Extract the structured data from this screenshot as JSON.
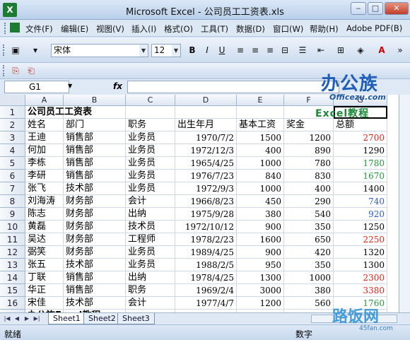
{
  "window": {
    "title": "Microsoft Excel - 公司员工工资表.xls",
    "app_icon": "X"
  },
  "menu": [
    "文件(F)",
    "编辑(E)",
    "视图(V)",
    "插入(I)",
    "格式(O)",
    "工具(T)",
    "数据(D)",
    "窗口(W)",
    "帮助(H)",
    "Adobe PDF(B)"
  ],
  "toolbar": {
    "font_name": "宋体",
    "font_size": "12",
    "bold": "B",
    "italic": "I",
    "underline": "U",
    "font_color_label": "A"
  },
  "formula_bar": {
    "name_box": "G1",
    "fx": "fx",
    "formula": ""
  },
  "columns": [
    "A",
    "B",
    "C",
    "D",
    "E",
    "F",
    "G"
  ],
  "rows": [
    [
      "1",
      "公司员工工资表",
      "",
      "",
      "",
      "",
      "",
      ""
    ],
    [
      "2",
      "姓名",
      "部门",
      "职务",
      "出生年月",
      "基本工资",
      "奖金",
      "总额"
    ],
    [
      "3",
      "王迪",
      "销售部",
      "业务员",
      "1970/7/2",
      "1500",
      "1200",
      "2700"
    ],
    [
      "4",
      "何加",
      "销售部",
      "业务员",
      "1972/12/3",
      "400",
      "890",
      "1290"
    ],
    [
      "5",
      "李栋",
      "销售部",
      "业务员",
      "1965/4/25",
      "1000",
      "780",
      "1780"
    ],
    [
      "6",
      "李研",
      "销售部",
      "业务员",
      "1976/7/23",
      "840",
      "830",
      "1670"
    ],
    [
      "7",
      "张飞",
      "技术部",
      "业务员",
      "1972/9/3",
      "1000",
      "400",
      "1400"
    ],
    [
      "8",
      "刘海涛",
      "财务部",
      "会计",
      "1966/8/23",
      "450",
      "290",
      "740"
    ],
    [
      "9",
      "陈志",
      "财务部",
      "出纳",
      "1975/9/28",
      "380",
      "540",
      "920"
    ],
    [
      "10",
      "黄磊",
      "财务部",
      "技术员",
      "1972/10/12",
      "900",
      "350",
      "1250"
    ],
    [
      "11",
      "吴达",
      "财务部",
      "工程师",
      "1978/2/23",
      "1600",
      "650",
      "2250"
    ],
    [
      "12",
      "弼笑",
      "财务部",
      "业务员",
      "1989/4/25",
      "900",
      "420",
      "1320"
    ],
    [
      "13",
      "张五",
      "技术部",
      "业务员",
      "1988/2/5",
      "950",
      "350",
      "1300"
    ],
    [
      "14",
      "丁联",
      "销售部",
      "出纳",
      "1978/4/25",
      "1300",
      "1000",
      "2300"
    ],
    [
      "15",
      "华正",
      "销售部",
      "职务",
      "1969/2/4",
      "3000",
      "380",
      "3380"
    ],
    [
      "16",
      "宋佳",
      "技术部",
      "会计",
      "1977/4/7",
      "1200",
      "560",
      "1760"
    ],
    [
      "17",
      "办公族Excel教程",
      "",
      "",
      "",
      "",
      "",
      ""
    ]
  ],
  "total_colors": {
    "red": "#e0241b",
    "green": "#1f9a3a",
    "blue": "#2a5bd1",
    "black": "#000000"
  },
  "total_color_keys": [
    "",
    "",
    "red",
    "black",
    "green",
    "green",
    "black",
    "blue",
    "blue",
    "black",
    "red",
    "black",
    "black",
    "red",
    "red",
    "green",
    ""
  ],
  "sheets": [
    "Sheet1",
    "Sheet2",
    "Sheet3"
  ],
  "status": {
    "ready": "就绪",
    "mode": "数字"
  },
  "watermarks": {
    "top_logo": "办公族",
    "top_url": "Officezu.com",
    "excel_tag": "Excel教程",
    "bottom_logo": "路饭网",
    "bottom_url": "45fan.com"
  }
}
